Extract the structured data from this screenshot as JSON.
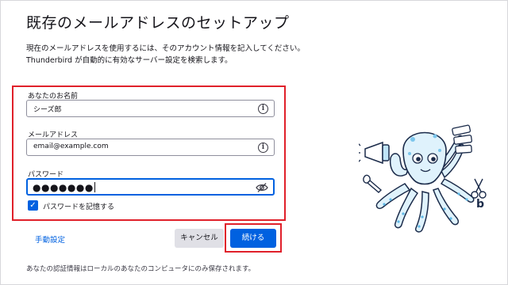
{
  "page": {
    "title": "既存のメールアドレスのセットアップ",
    "description_line1": "現在のメールアドレスを使用するには、そのアカウント情報を記入してください。",
    "description_line2": "Thunderbird が自動的に有効なサーバー設定を検索します。"
  },
  "form": {
    "name_label": "あなたのお名前",
    "name_value": "シーズ郎",
    "email_label": "メールアドレス",
    "email_value": "email@example.com",
    "password_label": "パスワード",
    "password_masked": "●●●●●●●",
    "remember_label": "パスワードを記憶する",
    "remember_checked": true
  },
  "actions": {
    "manual_config": "手動設定",
    "cancel": "キャンセル",
    "continue": "続ける"
  },
  "footer": {
    "note": "あなたの認証情報はローカルのあなたのコンピュータにのみ保存されます。"
  },
  "colors": {
    "accent": "#0061e0",
    "highlight": "#e0202a"
  },
  "icons": {
    "info": "info-icon",
    "eye_slash": "eye-slash-icon",
    "check": "check-icon"
  }
}
